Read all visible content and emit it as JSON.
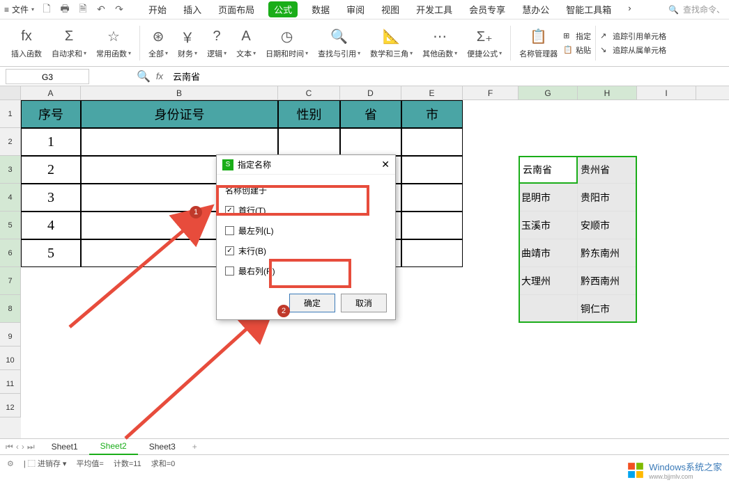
{
  "topbar": {
    "file": "文件",
    "tabs": [
      "开始",
      "插入",
      "页面布局",
      "公式",
      "数据",
      "审阅",
      "视图",
      "开发工具",
      "会员专享",
      "慧办公",
      "智能工具箱"
    ],
    "active_tab": 3,
    "search_placeholder": "查找命令、"
  },
  "ribbon": {
    "insert_fn": "插入函数",
    "auto_sum": "自动求和",
    "common_fn": "常用函数",
    "all": "全部",
    "finance": "财务",
    "logic": "逻辑",
    "text": "文本",
    "datetime": "日期和时间",
    "lookup": "查找与引用",
    "math": "数学和三角",
    "other_fn": "其他函数",
    "quick_formula": "便捷公式",
    "name_mgr": "名称管理器",
    "define_name": "指定",
    "paste": "粘贴",
    "trace_precedents": "追踪引用单元格",
    "trace_dependents": "追踪从属单元格"
  },
  "formula_bar": {
    "name_box": "G3",
    "formula": "云南省"
  },
  "columns": [
    "A",
    "B",
    "C",
    "D",
    "E",
    "F",
    "G",
    "H",
    "I"
  ],
  "rows": [
    "1",
    "2",
    "3",
    "4",
    "5",
    "6",
    "7",
    "8",
    "9",
    "10",
    "11",
    "12"
  ],
  "headers": {
    "A1": "序号",
    "B1": "身份证号",
    "C1": "性别",
    "D1": "省",
    "E1": "市"
  },
  "data_col_A": [
    "1",
    "2",
    "3",
    "4",
    "5"
  ],
  "data_GH": {
    "G3": "云南省",
    "H3": "贵州省",
    "G4": "昆明市",
    "H4": "贵阳市",
    "G5": "玉溪市",
    "H5": "安顺市",
    "G6": "曲靖市",
    "H6": "黔东南州",
    "G7": "大理州",
    "H7": "黔西南州",
    "H8": "铜仁市"
  },
  "dialog": {
    "title": "指定名称",
    "subtitle": "名称创建于",
    "opt_top": "首行(T)",
    "opt_left": "最左列(L)",
    "opt_bottom": "末行(B)",
    "opt_right": "最右列(R)",
    "ok": "确定",
    "cancel": "取消"
  },
  "badges": {
    "b1": "1",
    "b2": "2"
  },
  "sheet_tabs": [
    "Sheet1",
    "Sheet2",
    "Sheet3"
  ],
  "active_sheet": 1,
  "status": {
    "undo": "进销存",
    "avg": "平均值=",
    "count": "计数=11",
    "sum": "求和=0"
  },
  "watermark": {
    "title": "Windows系统之家",
    "url": "www.bjjmlv.com"
  }
}
